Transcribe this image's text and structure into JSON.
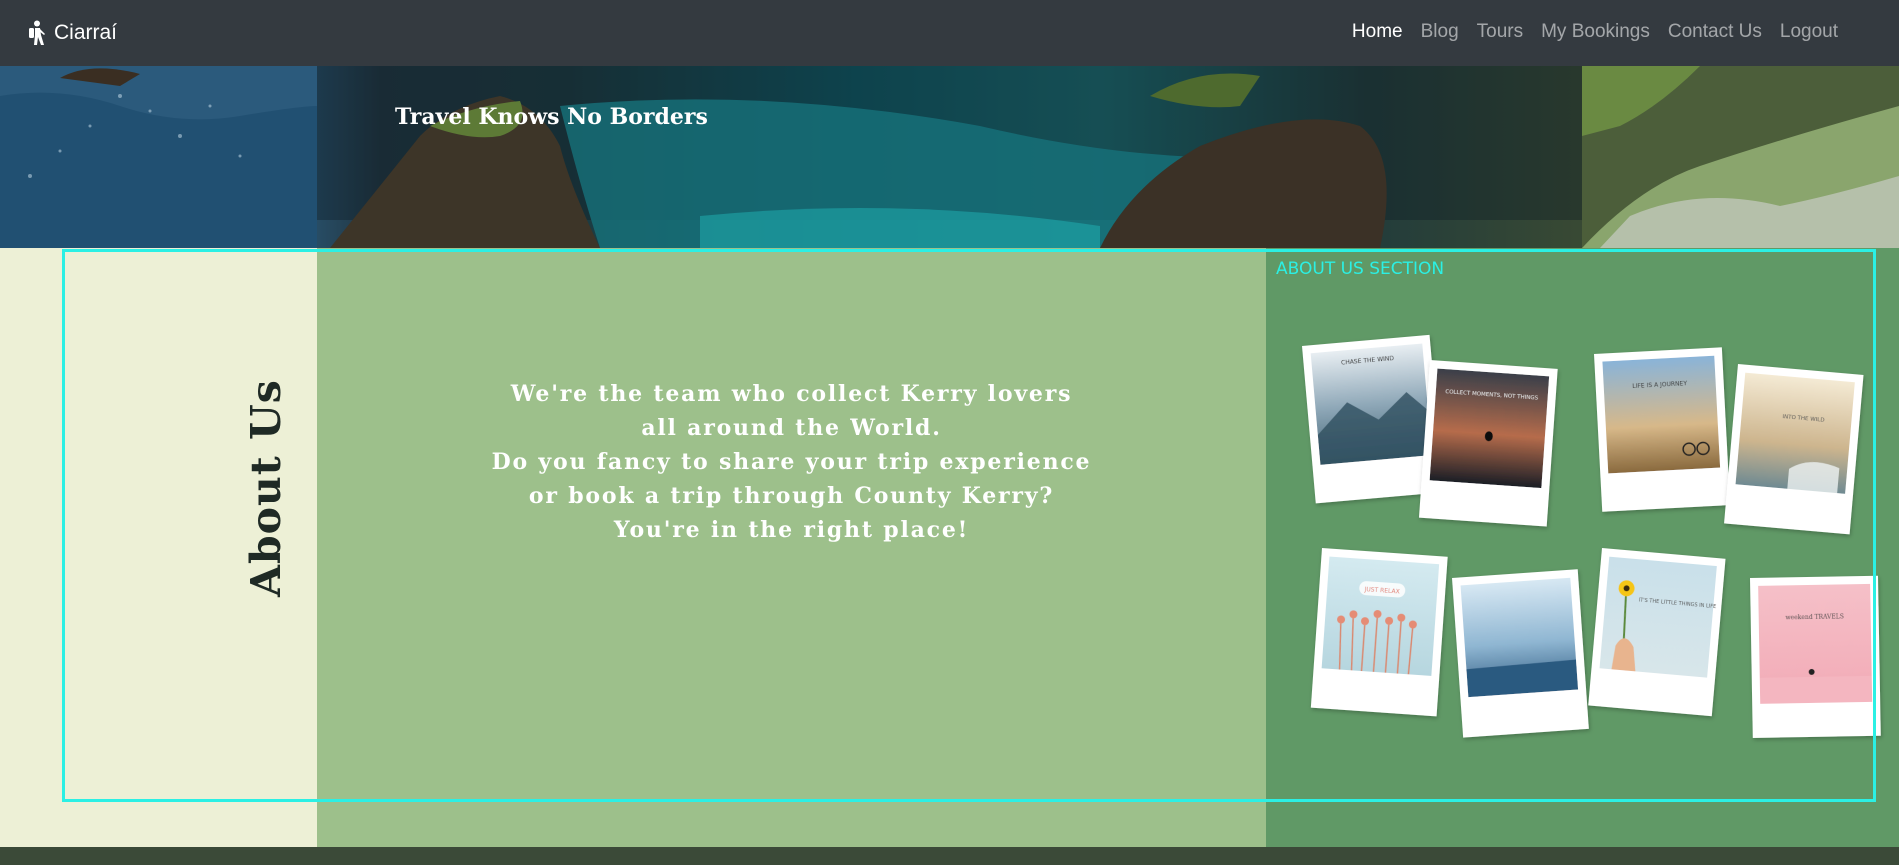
{
  "navbar": {
    "brand": "Ciarraí",
    "brand_icon": "hiker-icon",
    "links": [
      {
        "label": "Home",
        "active": true
      },
      {
        "label": "Blog",
        "active": false
      },
      {
        "label": "Tours",
        "active": false
      },
      {
        "label": "My Bookings",
        "active": false
      },
      {
        "label": "Contact Us",
        "active": false
      },
      {
        "label": "Logout",
        "active": false
      }
    ]
  },
  "hero": {
    "title": "Travel Knows No Borders"
  },
  "about": {
    "title": "About Us",
    "section_label": "ABOUT US SECTION",
    "text_lines": [
      "We're the team who collect Kerry lovers",
      "all around the World.",
      "Do you fancy to share your trip experience",
      "or book a trip through County Kerry?",
      "You're in the right place!"
    ],
    "polaroids": [
      {
        "caption": "CHASE THE WIND"
      },
      {
        "caption": "COLLECT MOMENTS, NOT THINGS"
      },
      {
        "caption": "LIFE IS A JOURNEY"
      },
      {
        "caption": "INTO THE WILD"
      },
      {
        "caption": "JUST RELAX"
      },
      {
        "caption": ""
      },
      {
        "caption": "IT'S THE LITTLE THINGS IN LIFE"
      },
      {
        "caption": "weekend TRAVELS"
      }
    ]
  },
  "colors": {
    "navbar": "#343a40",
    "cream": "#edf0d6",
    "sage": "#9dc08b",
    "green": "#609966",
    "accent_outline": "#2bf0e4",
    "footer": "#3b4a38"
  }
}
